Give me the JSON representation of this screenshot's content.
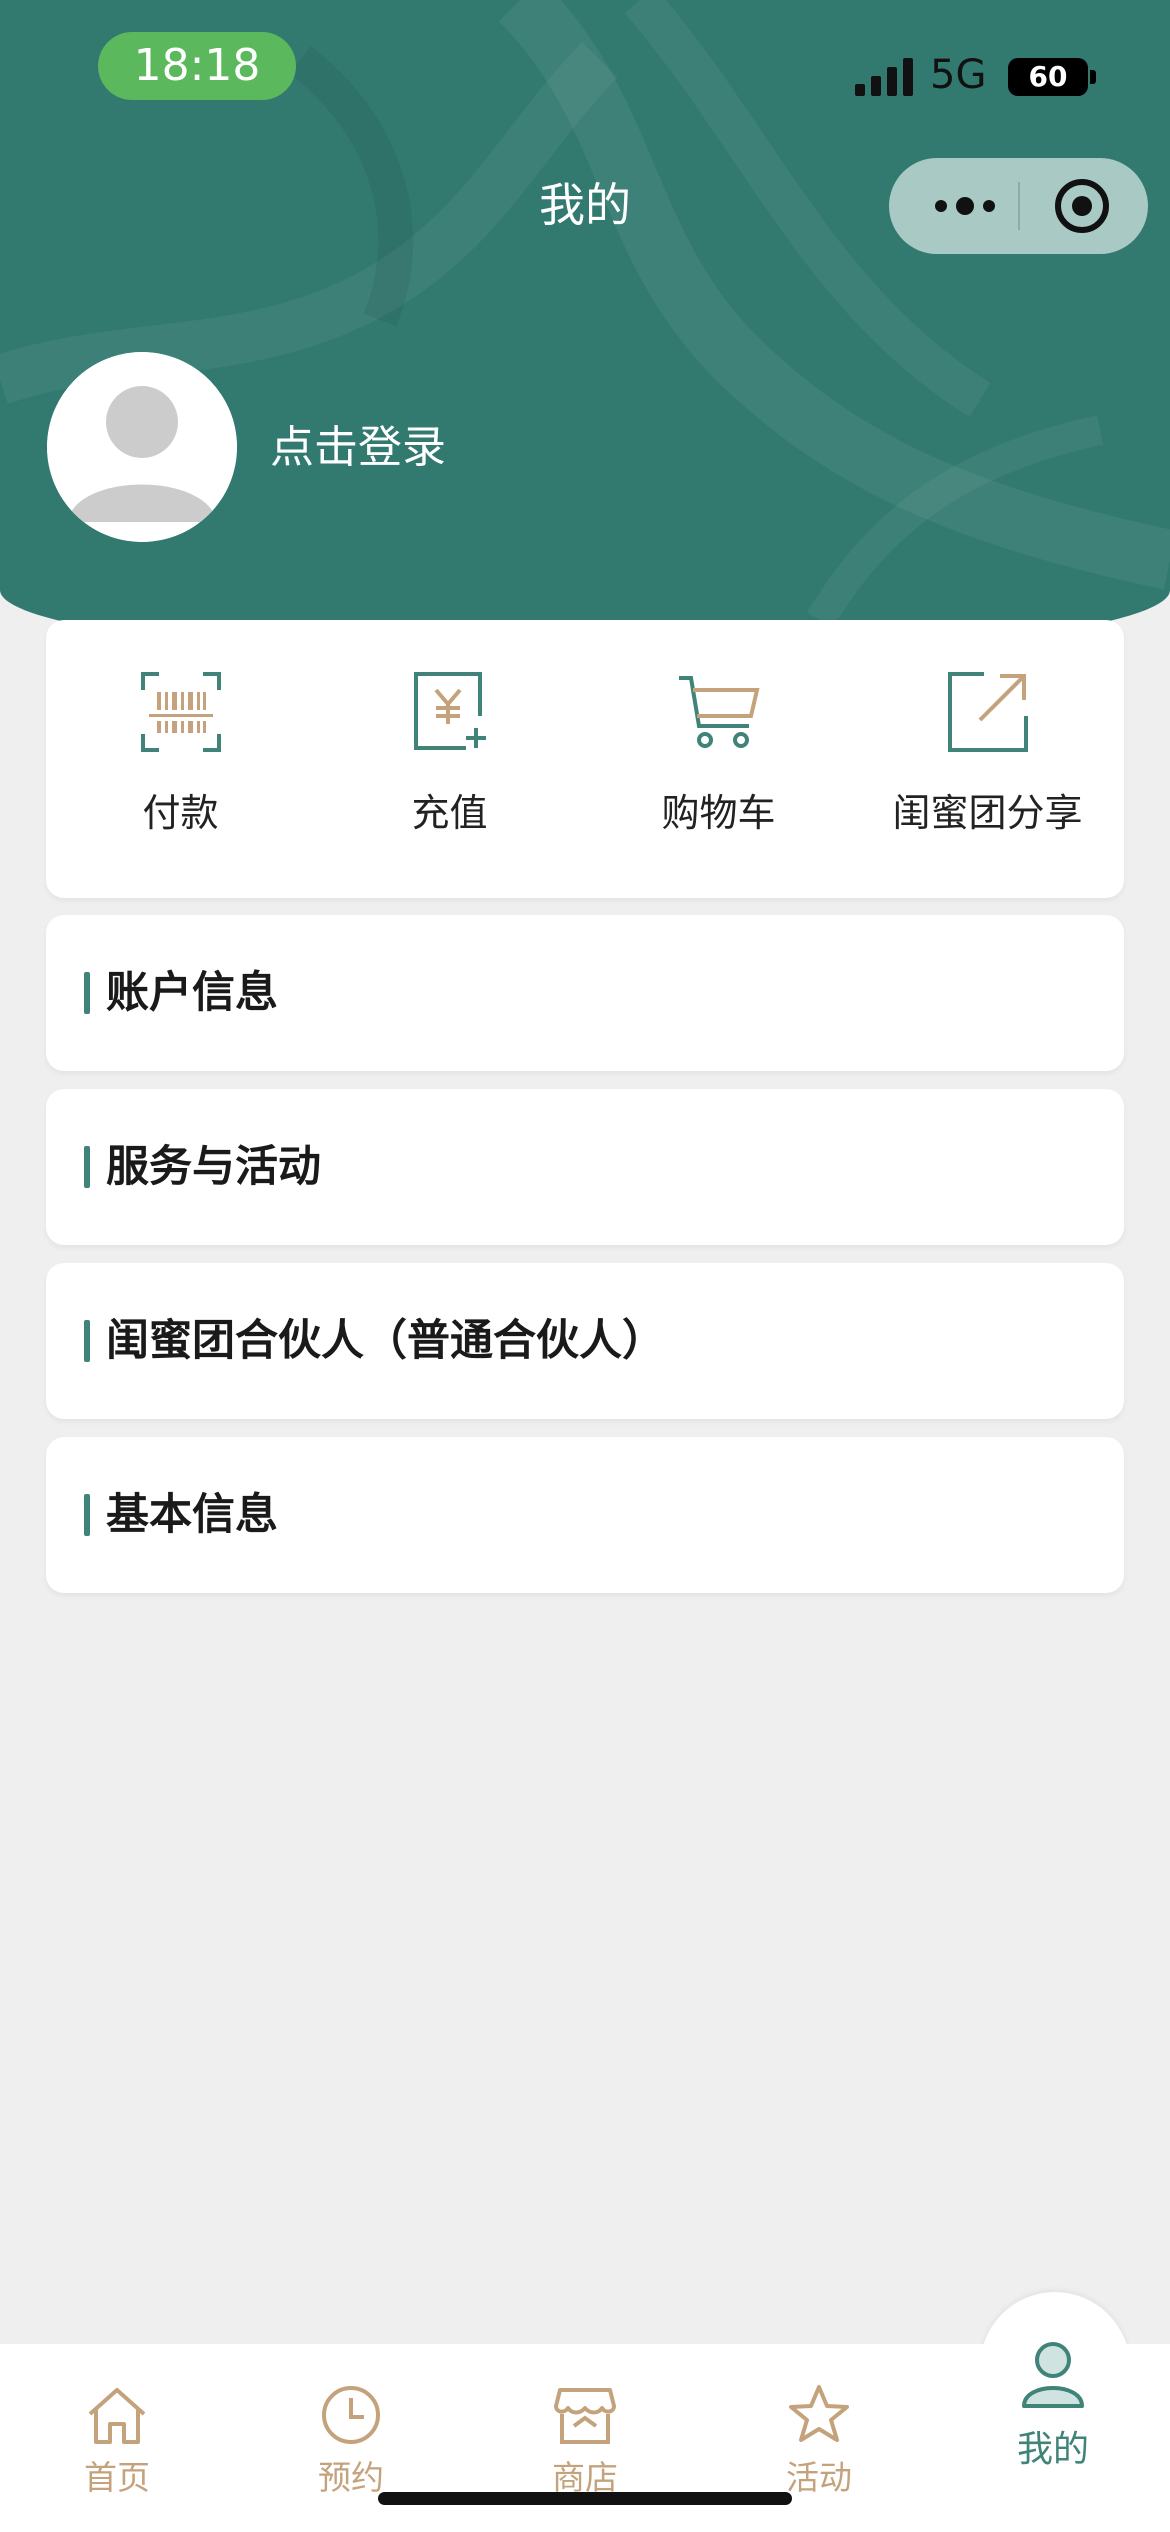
{
  "status_bar": {
    "time": "18:18",
    "network": "5G",
    "battery": "60"
  },
  "nav": {
    "title": "我的"
  },
  "profile": {
    "login_prompt": "点击登录"
  },
  "quick_actions": [
    {
      "label": "付款",
      "icon": "barcode-scan-icon"
    },
    {
      "label": "充值",
      "icon": "recharge-icon"
    },
    {
      "label": "购物车",
      "icon": "cart-icon"
    },
    {
      "label": "闺蜜团分享",
      "icon": "share-icon"
    }
  ],
  "sections": [
    {
      "title": "账户信息"
    },
    {
      "title": "服务与活动"
    },
    {
      "title": "闺蜜团合伙人（普通合伙人）"
    },
    {
      "title": "基本信息"
    }
  ],
  "tabbar": {
    "items": [
      {
        "label": "首页",
        "icon": "home-icon"
      },
      {
        "label": "预约",
        "icon": "clock-icon"
      },
      {
        "label": "商店",
        "icon": "store-icon"
      },
      {
        "label": "活动",
        "icon": "star-icon"
      },
      {
        "label": "我的",
        "icon": "user-icon"
      }
    ],
    "active": "我的"
  },
  "colors": {
    "theme": "#327a70",
    "gold": "#c4a37c",
    "accent_bar": "#3f8379"
  }
}
